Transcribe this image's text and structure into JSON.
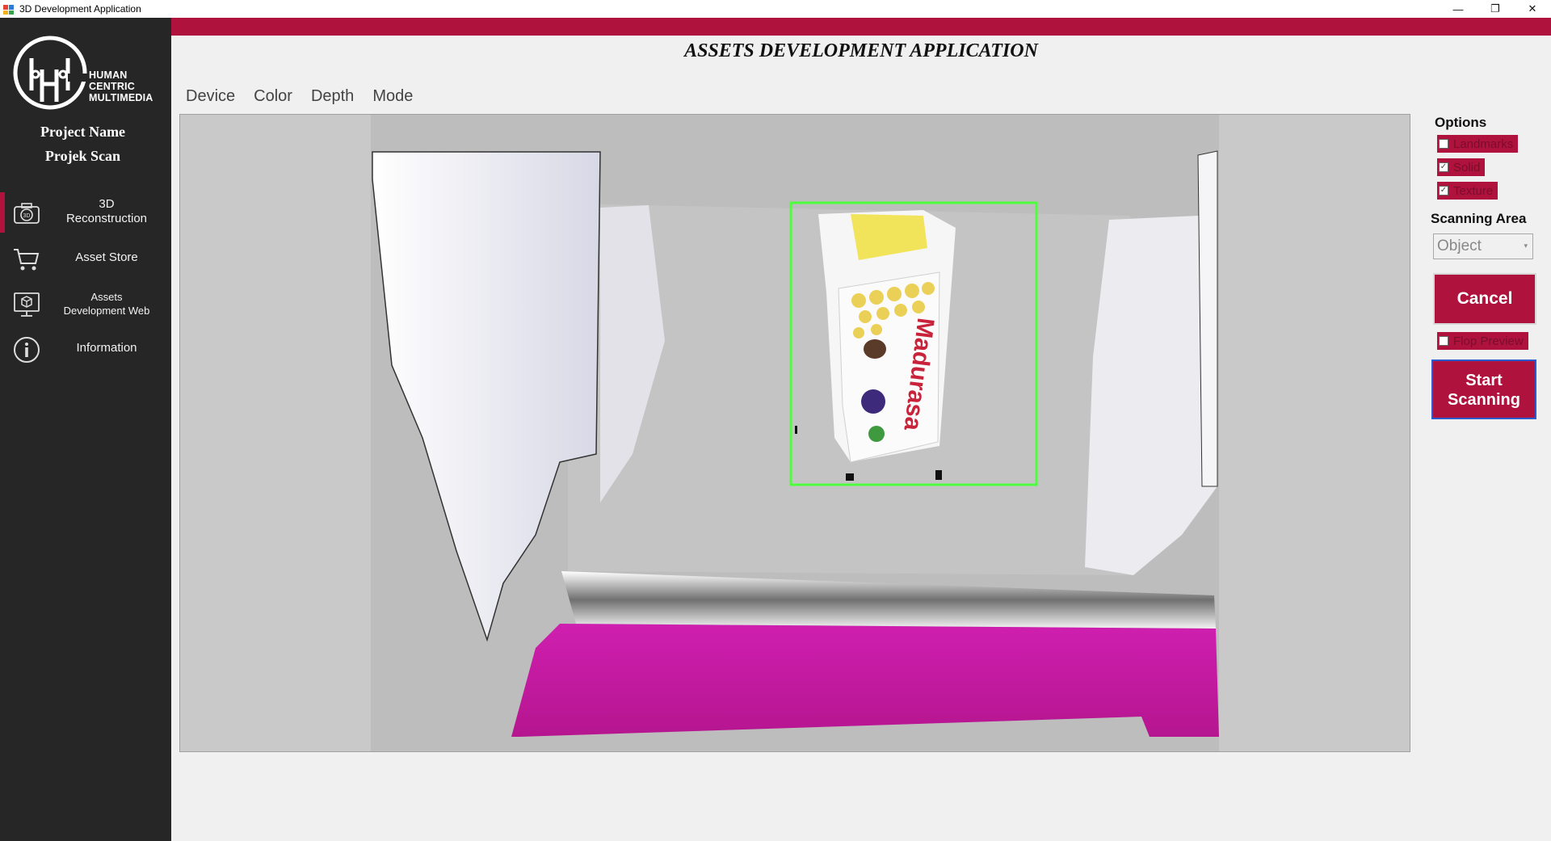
{
  "window": {
    "title": "3D Development Application",
    "controls": {
      "minimize": "—",
      "restore": "❐",
      "close": "✕"
    }
  },
  "sidebar": {
    "logo_text": [
      "HUMAN",
      "CENTRIC",
      "MULTIMEDIA"
    ],
    "project_label": "Project Name",
    "project_value": "Projek Scan",
    "items": [
      {
        "label": "3D Reconstruction",
        "lines": [
          "3D",
          "Reconstruction"
        ],
        "icon": "camera-3d-icon",
        "active": true
      },
      {
        "label": "Asset Store",
        "lines": [
          "Asset Store"
        ],
        "icon": "cart-icon",
        "active": false
      },
      {
        "label": "Assets Development Web",
        "lines": [
          "Assets",
          "Development Web"
        ],
        "icon": "monitor-cube-icon",
        "active": false
      },
      {
        "label": "Information",
        "lines": [
          "Information"
        ],
        "icon": "info-icon",
        "active": false
      }
    ]
  },
  "main": {
    "title": "ASSETS DEVELOPMENT APPLICATION",
    "menu": [
      "Device",
      "Color",
      "Depth",
      "Mode"
    ]
  },
  "options": {
    "label": "Options",
    "checkboxes": [
      {
        "label": "Landmarks",
        "checked": false
      },
      {
        "label": "Solid",
        "checked": true
      },
      {
        "label": "Texture",
        "checked": true
      }
    ],
    "scanning_area_label": "Scanning Area",
    "scanning_area_value": "Object",
    "cancel_label": "Cancel",
    "flop_preview_label": "Flop Preview",
    "flop_preview_checked": false,
    "start_label_line1": "Start",
    "start_label_line2": "Scanning"
  },
  "colors": {
    "accent": "#b0123e",
    "sidebar": "#262626",
    "bounding_box": "#4cff3a",
    "floor": "#c0169b"
  }
}
